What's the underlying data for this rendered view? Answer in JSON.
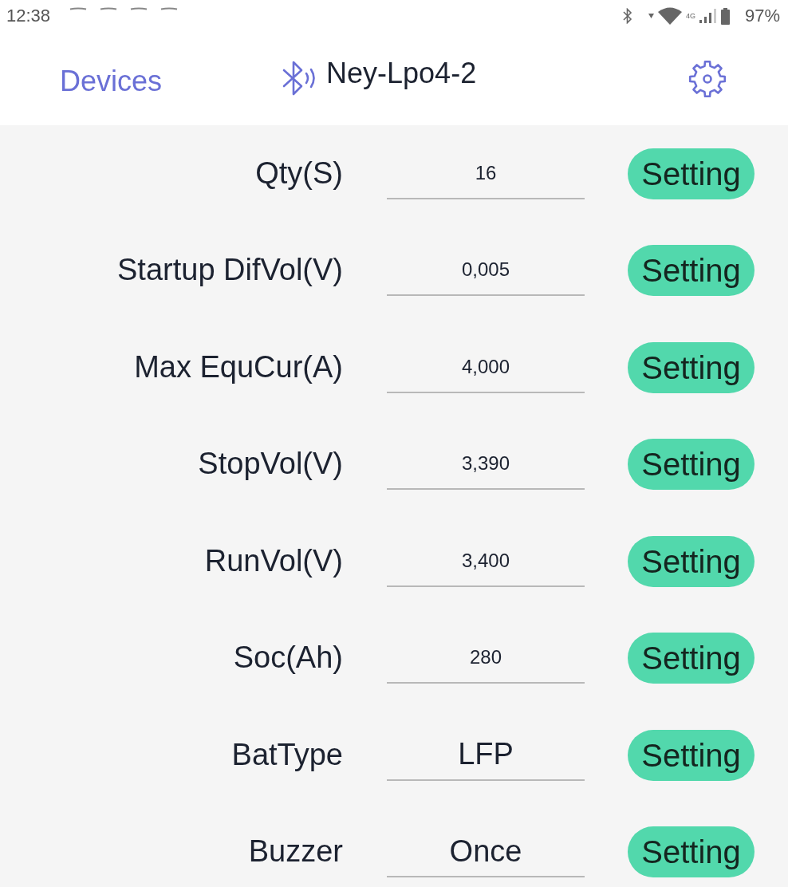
{
  "status_bar": {
    "time": "12:38",
    "network_type": "4G",
    "battery": "97%"
  },
  "header": {
    "back_link": "Devices",
    "title": "Ney-Lpo4-2"
  },
  "settings": [
    {
      "label": "Qty(S)",
      "value": "16",
      "kind": "number",
      "button": "Setting"
    },
    {
      "label": "Startup DifVol(V)",
      "value": "0,005",
      "kind": "number",
      "button": "Setting"
    },
    {
      "label": "Max EquCur(A)",
      "value": "4,000",
      "kind": "number",
      "button": "Setting"
    },
    {
      "label": "StopVol(V)",
      "value": "3,390",
      "kind": "number",
      "button": "Setting"
    },
    {
      "label": "RunVol(V)",
      "value": "3,400",
      "kind": "number",
      "button": "Setting"
    },
    {
      "label": "Soc(Ah)",
      "value": "280",
      "kind": "number",
      "button": "Setting"
    },
    {
      "label": "BatType",
      "value": "LFP",
      "kind": "choice",
      "button": "Setting"
    },
    {
      "label": "Buzzer",
      "value": "Once",
      "kind": "choice",
      "button": "Setting"
    }
  ]
}
